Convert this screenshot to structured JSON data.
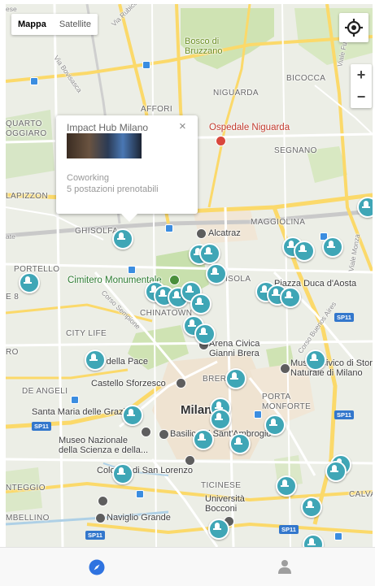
{
  "map_controls": {
    "map_type_options": [
      "Mappa",
      "Satellite"
    ],
    "zoom_in": "+",
    "zoom_out": "−"
  },
  "popup": {
    "title": "Impact Hub Milano",
    "close": "×",
    "category": "Coworking",
    "description": "5 postazioni prenotabili"
  },
  "map_labels": {
    "rubicone": "Via Rubicone",
    "fulvio_testi": "Viale Fulvio Testi",
    "bosco": "Bosco di\nBruzzano",
    "bovisasca": "Via Bovisasca",
    "bicocca": "BICOCCA",
    "quarto_oggiaro": "QUARTO\nOGGIARO",
    "niguarda": "NIGUARDA",
    "affori": "AFFORI",
    "ospedale": "Ospedale Niguarda",
    "segnano": "SEGNANO",
    "lapizzon": "LAPIZZON",
    "maggiolina": "MAGGIOLINA",
    "ghisolfa": "GHISOLFA",
    "alcatraz": "Alcatraz",
    "isola": "ISOLA",
    "monza": "Viale Monza",
    "portello": "PORTELLO",
    "cimitero": "Cimitero Monumentale",
    "duca_aosta": "Piazza Duca d'Aosta",
    "chinatown": "CHINATOWN",
    "sempione": "Corso Sempione",
    "city_life": "CITY LIFE",
    "buenos_aires": "Corso Buenos Aires",
    "arena": "Arena Civica\nGianni Brera",
    "arco": "Arco della Pace",
    "museo_civico": "Museo Civico di Stor\nNaturale di Milano",
    "castello": "Castello Sforzesco",
    "brera": "BRERA",
    "de_angeli": "DE ANGELI",
    "porta_monforte": "PORTA\nMONFORTE",
    "santa_maria": "Santa Maria delle Grazie",
    "milano": "Milano",
    "basilica": "Basilica di Sant'Ambrogio",
    "museo_scienza": "Museo Nazionale\ndella Scienza e della...",
    "colonne": "Colonne di San Lorenzo",
    "ticinese": "TICINESE",
    "universita": "Università\nBocconi",
    "ntegg": "NTEGGIO",
    "calva": "CALVA",
    "mbellino": "MBELLINO",
    "naviglio": "Naviglio Grande",
    "ate": "ate",
    "e8": "E 8",
    "ro": "RO",
    "ese": "ese"
  },
  "road_badges": {
    "sp11_a": "SP11",
    "sp11_b": "SP11",
    "sp11_c": "SP11",
    "sp11_d": "SP11",
    "sp11_e": "SP11"
  },
  "bottom_nav": {
    "items": [
      {
        "name": "explore",
        "icon": "compass-icon",
        "active": true,
        "color": "#2f73e0"
      },
      {
        "name": "profile",
        "icon": "person-icon",
        "active": false,
        "color": "#9e9e9e"
      }
    ]
  },
  "colors": {
    "marker": "#3fa6b6",
    "accent": "#2f73e0"
  }
}
